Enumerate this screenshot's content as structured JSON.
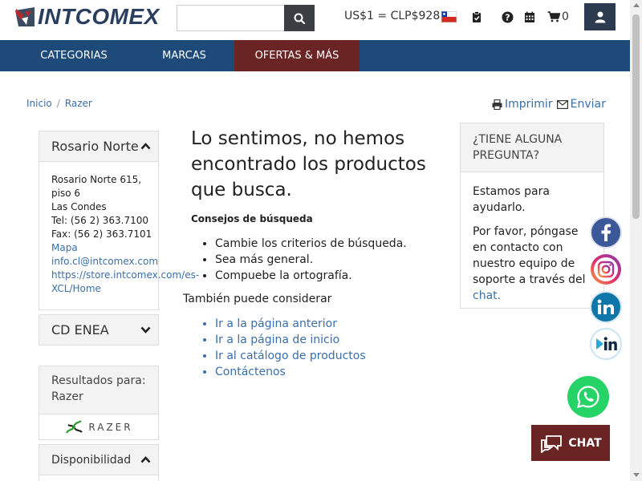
{
  "header": {
    "logo_text": "INTCOMEX",
    "search": {
      "value": "",
      "placeholder": ""
    },
    "exchange_rate": "US$1 = CLP$928",
    "cart_count": "0"
  },
  "nav": {
    "items": [
      {
        "label": "CATEGORIAS"
      },
      {
        "label": "MARCAS"
      },
      {
        "label": "OFERTAS & MÁS"
      }
    ]
  },
  "breadcrumb": {
    "items": [
      "Inicio",
      "Razer"
    ]
  },
  "tools": {
    "print_label": "Imprimir",
    "send_label": "Enviar"
  },
  "sidebar": {
    "branch1": {
      "title": "Rosario Norte",
      "lines": [
        "Rosario Norte 615,",
        "piso 6",
        "Las Condes",
        "Tel: (56 2) 363.7100",
        "Fax: (56 2) 363.7101"
      ],
      "map_link": "Mapa",
      "email": "info.cl@intcomex.com",
      "url_line1": "https://store.intcomex.com/es-",
      "url_line2": "XCL/Home"
    },
    "branch2": {
      "title": "CD ENEA"
    },
    "results": {
      "line1": "Resultados para:",
      "line2": "Razer",
      "brand_logo_text": "RAZER"
    },
    "availability": {
      "title": "Disponibilidad"
    }
  },
  "main": {
    "title": "Lo sentimos, no hemos encontrado los productos que busca.",
    "tips_title": "Consejos de búsqueda",
    "tips": [
      "Cambie los criterios de búsqueda.",
      "Sea más general.",
      "Compuebe la ortografía."
    ],
    "also_label": "También puede considerar",
    "links": [
      "Ir a la página anterior",
      "Ir a la página de inicio",
      "Ir al catálogo de productos",
      "Contáctenos"
    ]
  },
  "question_box": {
    "title": "¿TIENE ALGUNA PREGUNTA?",
    "p1": "Estamos para ayudarlo.",
    "p2_text": "Por favor, póngase en contacto con nuestro equipo de soporte a través del ",
    "p2_link": "chat."
  },
  "chat_button": {
    "label": "CHAT"
  },
  "colors": {
    "nav_bg": "#1e4a7a",
    "accent_red": "#6b2424",
    "link": "#3a6fa8",
    "facebook": "#3b5998",
    "linkedin": "#0e76a8",
    "whatsapp": "#25d366"
  },
  "icons": [
    "search-icon",
    "chile-flag-icon",
    "clipboard-check-icon",
    "help-icon",
    "calendar-icon",
    "cart-icon",
    "user-icon",
    "print-icon",
    "envelope-icon",
    "chevron-up-icon",
    "chevron-down-icon",
    "facebook-icon",
    "instagram-icon",
    "linkedin-icon",
    "linkedin-video-icon",
    "whatsapp-icon",
    "chat-icon"
  ]
}
